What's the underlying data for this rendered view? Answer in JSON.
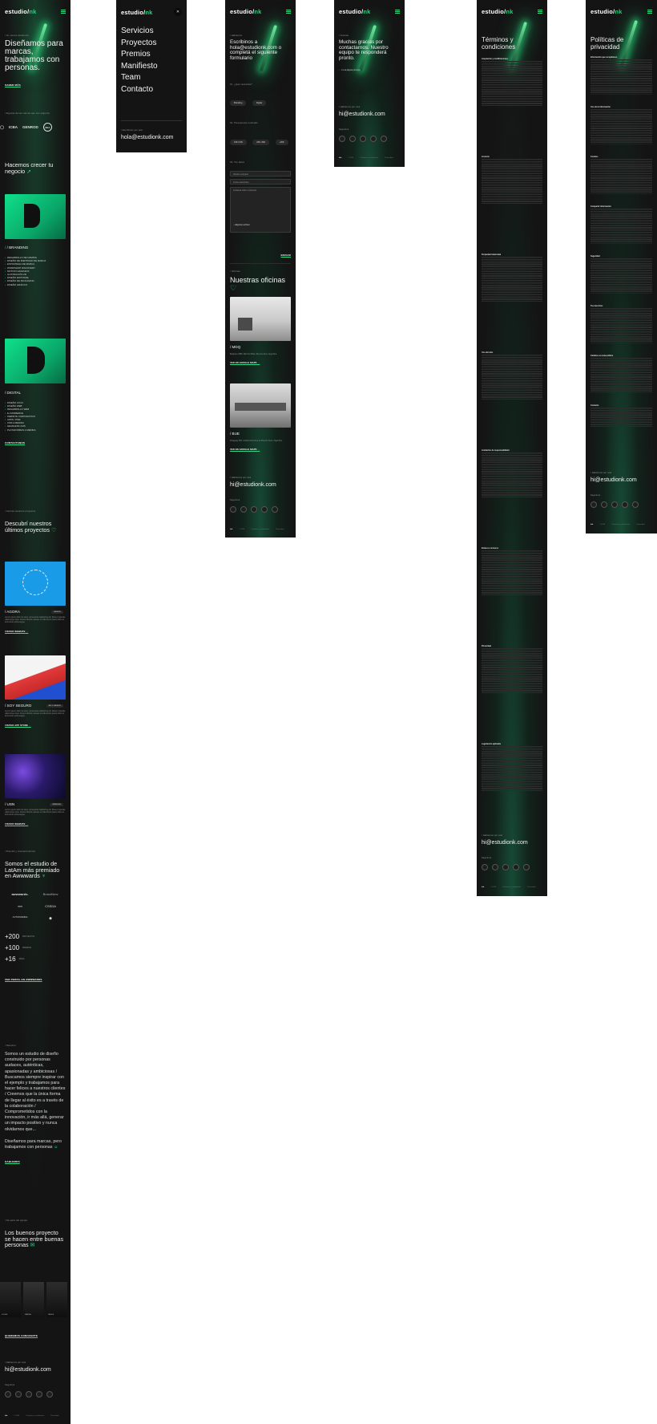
{
  "brand": {
    "logo_prefix": "estudio/",
    "logo_suffix": "nk",
    "accent": "#2ddc86",
    "background": "#141414"
  },
  "home": {
    "hero_eyebrow": "/ Hi, somos estudio/nk",
    "hero_title": "Diseñamos para marcas, trabajamos con personas.",
    "hero_link": "SABER MÁS",
    "clients_eyebrow": "/ Algunas de las marcas que nos eligieron",
    "clients": [
      "◯",
      "ICBA",
      "GENROD",
      "NEA"
    ],
    "grow_title": "Hacemos crecer tu negocio",
    "branding_label": "/ BRANDING",
    "branding_items": [
      "DESARROLLO DE NAMING",
      "DISEÑO DE IDENTIDAD DE MARCA",
      "ESTRATEGIA DE MARCA",
      "WORKSHOP DISCOVERY",
      "MOTION GRAPHICS",
      "ILUSTRACIÓN 2D",
      "DISEÑO EDITORIAL",
      "DISEÑO DE PACKAGING",
      "DISEÑO GRÁFICO"
    ],
    "digital_label": "/ DIGITAL",
    "digital_items": [
      "DISEÑO UX/UI",
      "DISEÑO WEB",
      "DESARROLLO WEB",
      "E-COMMERCE",
      "WEBSITE CORPORATIVO",
      "APPS / PWA",
      "CMS A MEDIDA",
      "HEADLESS CMS",
      "PLATAFORMAS A MEDIDA"
    ],
    "contact_link": "CONTACTANOS",
    "projects_eyebrow": "/ Conocé nuestros proyectos",
    "projects_title": "Descubrí nuestros últimos proyectos",
    "projects": [
      {
        "name": "/ AGORA",
        "tag": "WEBSITE",
        "desc": "Lorem ipsum dolor sit amet, consectetur adipiscing elit. Donec molestie ullamcorper ante. Donec lobortis, laoreet et nulla lorem ipsum dolor at, fermentum porta augue.",
        "link": "VISITAR WEBSITE"
      },
      {
        "name": "/ SOY SEGURO",
        "tag": "APP & WEBSITE",
        "desc": "Lorem ipsum dolor sit amet, consectetur adipiscing elit. Donec molestie ullamcorper ante. Donec lobortis, laoreet et nulla lorem ipsum dolor at, fermentum porta augue.",
        "link": "VISITAR APP STORE"
      },
      {
        "name": "/ USN",
        "tag": "BRANDING",
        "desc": "Lorem ipsum dolor sit amet, consectetur adipiscing elit. Donec molestie ullamcorper ante. Donec lobortis, laoreet et nulla lorem ipsum dolor at, fermentum porta augue.",
        "link": "VISITAR WEBSITE"
      }
    ],
    "awards_eyebrow": "/ Premios y reconocimientos",
    "awards_title": "Somos el estudio de LatAm más premiado en Awwwards",
    "award_logos": [
      "awwwards.",
      "BrandNew",
      "∞∞",
      "CSSDA",
      "OUTSTANDING",
      "⬢"
    ],
    "stats": [
      {
        "value": "+200",
        "label": "PROYECTOS"
      },
      {
        "value": "+100",
        "label": "PREMIOS"
      },
      {
        "value": "+16",
        "label": "AÑOS"
      }
    ],
    "awwwards_link": "VER PERFIL EN AWWWARDS",
    "about_eyebrow": "/ Nosotros",
    "about_text": "Somos un estudio de diseño construido por personas audaces, auténticas, apasionadas y ambiciosas / Buscamos siempre inspirar con el ejemplo y trabajamos para hacer felices a nuestros clientes / Creemos que la única forma de llegar al éxito es a través de la colaboración / Comprometidos con la innovación, ir más allá, generar un impacto positivo y nunca olvidarnos que...",
    "about_sub": "Diseñamos para marcas, pero trabajamos con personas",
    "about_link": "HABLEMOS",
    "team_eyebrow": "/ Sé parte del equipo",
    "team_title": "Los buenos proyecto se hacen entre buenas personas",
    "team_names": [
      "LUCAS",
      "MATÍAS",
      "PAULA",
      ""
    ],
    "team_link": "QUEREMOS CONOCERTE",
    "footer_eyebrow": "/ Hablemos por acá",
    "footer_email": "hi@estudionk.com",
    "follow_label": "Seguinos",
    "footer_links": [
      "© 2024",
      "Términos y condiciones",
      "Privacidad"
    ]
  },
  "menu": {
    "items": [
      "Servicios",
      "Proyectos",
      "Premios",
      "Manifiesto",
      "Team",
      "Contacto"
    ],
    "footer_eyebrow": "/ Escribinos por acá",
    "email": "hola@estudionk.com"
  },
  "contact": {
    "eyebrow": "/ Hablemos",
    "title": "Escribinos a hola@estudionk.com o completá el siguiente formulario",
    "q_service": "01. ¿Qué necesitás?",
    "service_options": [
      "Branding",
      "Digital"
    ],
    "q_budget": "02. Presupuesto estimado",
    "budget_options": [
      "10K USD",
      "20K USD",
      "+30K"
    ],
    "q_data": "03. Tus datos",
    "fields": [
      "Nombre completo",
      "Correo electrónico",
      "Contanos sobre el proyecto"
    ],
    "attach": "Adjuntar archivo",
    "submit": "ENVIAR",
    "offices_eyebrow": "/ Oficinas",
    "offices_title": "Nuestras oficinas",
    "offices": [
      {
        "code": "/ MDQ",
        "address": "Belgrano 2880, Mar Del Plata, Buenos Aires, Argentina",
        "link": "VER EN GOOGLE MAPS"
      },
      {
        "code": "/ BUE",
        "address": "Paraguay 609, Ciudad Autónoma de Buenos Aires, Argentina",
        "link": "VER EN GOOGLE MAPS"
      }
    ]
  },
  "thanks": {
    "eyebrow": "/ Gracias",
    "title": "Muchas gracias por contactarnos. Nuestro equipo te responderá pronto.",
    "back": "Ir a la página principal"
  },
  "terms": {
    "title": "Términos y condiciones",
    "sections": [
      "Aceptación y modificaciones",
      "Licencia",
      "Propiedad intelectual",
      "Uso del sitio",
      "Limitación de responsabilidad",
      "Enlaces a terceros",
      "Privacidad",
      "Legislación aplicable",
      "Contacto"
    ]
  },
  "privacy": {
    "title": "Políticas de privacidad",
    "sections": [
      "Información que recopilamos",
      "Uso de la información",
      "Cookies",
      "Compartir información",
      "Seguridad",
      "Tus derechos",
      "Cambios en esta política",
      "Contacto"
    ]
  }
}
